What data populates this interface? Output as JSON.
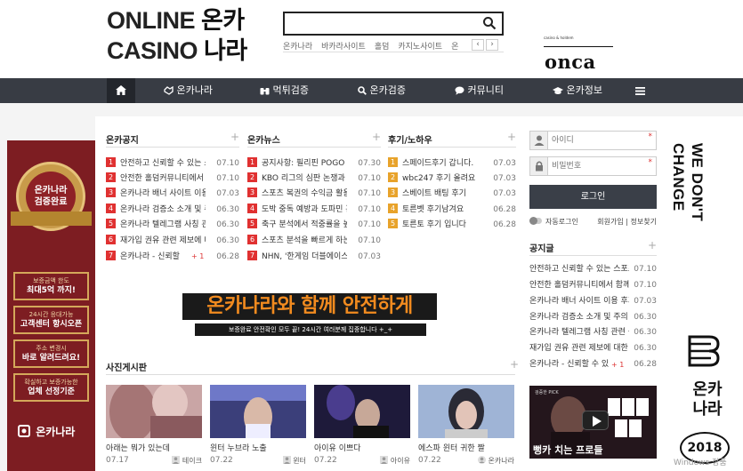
{
  "header": {
    "logo_en_1": "ONLINE",
    "logo_ko_1": "온카",
    "logo_en_2": "CASINO",
    "logo_ko_2": "나라",
    "search_value": "",
    "keywords": [
      "온카나라",
      "바카라사이트",
      "홀덤",
      "카지노사이트",
      "온"
    ],
    "kw_prev": "‹",
    "kw_next": "›",
    "onca_tagline": "casino & holdem",
    "onca_brand": "onca"
  },
  "nav": {
    "items": [
      "온카나라",
      "먹튀검증",
      "온카검증",
      "커뮤니티",
      "온카정보"
    ]
  },
  "notice": {
    "title": "온카공지",
    "plus": "+",
    "rows": [
      {
        "n": "1",
        "t": "안전하고 신뢰할 수 있는 스포츠",
        "d": "07.10",
        "c": ""
      },
      {
        "n": "2",
        "t": "안전한 홀덤커뮤니티에서 함께",
        "d": "07.10",
        "c": ""
      },
      {
        "n": "3",
        "t": "온카나라 배너 사이트 이용 후기",
        "d": "07.03",
        "c": ""
      },
      {
        "n": "4",
        "t": "온카나라 검증소 소개 및 주의",
        "d": "06.30",
        "c": ""
      },
      {
        "n": "5",
        "t": "온카나라 텔레그램 사칭 관련 공지",
        "d": "06.30",
        "c": ""
      },
      {
        "n": "6",
        "t": "재가입 권유 관련 제보에 대한",
        "d": "06.30",
        "c": ""
      },
      {
        "n": "7",
        "t": "온카나라 - 신뢰할",
        "d": "06.28",
        "c": "+ 1"
      }
    ]
  },
  "news": {
    "title": "온카뉴스",
    "plus": "+",
    "rows": [
      {
        "n": "1",
        "t": "공지사항: 필리핀 POGO 관련",
        "d": "07.30"
      },
      {
        "n": "2",
        "t": "KBO 리그의 심판 논쟁과 개선",
        "d": "07.10"
      },
      {
        "n": "3",
        "t": "스포츠 복권의 수익금 활용",
        "d": "07.10"
      },
      {
        "n": "4",
        "t": "도박 중독 예방과 도파민 관리",
        "d": "07.10"
      },
      {
        "n": "5",
        "t": "축구 분석에서 적중률을 높이는",
        "d": "07.10"
      },
      {
        "n": "6",
        "t": "스포츠 분석을 빠르게 하는 방법",
        "d": "07.10"
      },
      {
        "n": "7",
        "t": "NHN, '한게임 더블에이스'",
        "d": "07.03"
      }
    ]
  },
  "reviews": {
    "title": "후기/노하우",
    "plus": "+",
    "rows": [
      {
        "n": "1",
        "t": "스페이드후기 갑니다.",
        "d": "07.03"
      },
      {
        "n": "2",
        "t": "wbc247 후기 올려요",
        "d": "07.03"
      },
      {
        "n": "3",
        "t": "스베이트 배팅 후기",
        "d": "07.03"
      },
      {
        "n": "4",
        "t": "토른벳 후기남겨요",
        "d": "06.28"
      },
      {
        "n": "5",
        "t": "토른토 후기 입니다",
        "d": "06.28"
      }
    ]
  },
  "mid_banner": {
    "headline": "온카나라와 함께 안전하게",
    "sub": "보증완료 안전확인 모두 끝! 24시간 여러분께 집중합니다 +_+"
  },
  "photos": {
    "title": "사진게시판",
    "plus": "+",
    "cards": [
      {
        "cap": "아래는 뭐가 있는데",
        "dt": "07.17",
        "au": "테이크"
      },
      {
        "cap": "윈터 누브라 노출",
        "dt": "07.22",
        "au": "윈터"
      },
      {
        "cap": "아이유 이쁘다",
        "dt": "07.22",
        "au": "아이유"
      },
      {
        "cap": "에스파 윈터 귀한 짤",
        "dt": "07.22",
        "au": "온카나라"
      }
    ]
  },
  "login": {
    "id_placeholder": "아이디",
    "pw_placeholder": "비밀번호",
    "required": "*",
    "button": "로그인",
    "auto_label": "자동로그인",
    "join": "회원가입",
    "sep": "|",
    "find": "정보찾기"
  },
  "notice2": {
    "title": "공지글",
    "plus": "+",
    "rows": [
      {
        "t": "안전하고 신뢰할 수 있는 스포츠",
        "d": "07.10",
        "c": ""
      },
      {
        "t": "안전한 홀덤커뮤니티에서 함께",
        "d": "07.10",
        "c": ""
      },
      {
        "t": "온카나라 배너 사이트 이용 후기",
        "d": "07.03",
        "c": ""
      },
      {
        "t": "온카나라 검증소 소개 및 주의",
        "d": "06.30",
        "c": ""
      },
      {
        "t": "온카나라 텔레그램 사칭 관련 공지",
        "d": "06.30",
        "c": ""
      },
      {
        "t": "재가입 권유 관련 제보에 대한 안내",
        "d": "06.30",
        "c": ""
      },
      {
        "t": "온카나라 - 신뢰할 수 있",
        "d": "06.28",
        "c": "+ 1"
      }
    ]
  },
  "video": {
    "tag": "검증한 PICK",
    "caption": "뻥카 치는 프로들"
  },
  "left_banner": {
    "medal_1": "온카나라",
    "medal_2": "검증완료",
    "box1_s": "보증금액 한도",
    "box1_b": "최대5억 까지!",
    "box2_s": "24시간 응대가능",
    "box2_b": "고객센터 항시오픈",
    "box3_s": "주소 변경시",
    "box3_b": "바로 알려드려요!",
    "box4_s": "확실하고 보증가능한",
    "box4_b": "업체 선정기준",
    "brand": "온카나라"
  },
  "right_banner": {
    "line1": "WE DON'T",
    "line2": "CHANGE",
    "ko": "온카\n나라",
    "year": "2018"
  },
  "watermark": "Windows 정품"
}
